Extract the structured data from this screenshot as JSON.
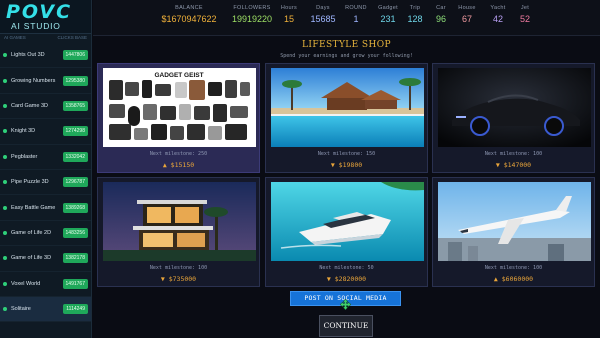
{
  "app": {
    "logo_main": "POVC",
    "logo_sub": "AI STUDIO"
  },
  "sidebar": {
    "header_left": "AI GAMES",
    "header_right": "CLICKS BASE",
    "items": [
      {
        "label": "Lights Out 3D",
        "count": "1447806"
      },
      {
        "label": "Growing Numbers",
        "count": "1295380"
      },
      {
        "label": "Card Game 3D",
        "count": "1358765"
      },
      {
        "label": "Knight 3D",
        "count": "1274298"
      },
      {
        "label": "Pegblaster",
        "count": "1332042"
      },
      {
        "label": "Pipe Puzzle 3D",
        "count": "1296787"
      },
      {
        "label": "Easy Battle Game",
        "count": "1389268"
      },
      {
        "label": "Game of Life 2D",
        "count": "1483256"
      },
      {
        "label": "Game of Life 3D",
        "count": "1382178"
      },
      {
        "label": "Voxel World",
        "count": "1491767"
      },
      {
        "label": "Solitaire",
        "count": "1114249"
      }
    ]
  },
  "stats": [
    {
      "label": "BALANCE",
      "value": "$1670947622",
      "color": "#f0b13a"
    },
    {
      "label": "FOLLOWERS",
      "value": "19919220",
      "color": "#9ee065"
    },
    {
      "label": "Hours",
      "value": "15",
      "color": "#f0b13a"
    },
    {
      "label": "Days",
      "value": "15685",
      "color": "#9fb6ff"
    },
    {
      "label": "ROUND",
      "value": "1",
      "color": "#9fb6ff"
    },
    {
      "label": "Gadget",
      "value": "231",
      "color": "#6fd6e8"
    },
    {
      "label": "Trip",
      "value": "128",
      "color": "#6fd6e8"
    },
    {
      "label": "Car",
      "value": "96",
      "color": "#8fe07a"
    },
    {
      "label": "House",
      "value": "67",
      "color": "#f09aa0"
    },
    {
      "label": "Yacht",
      "value": "42",
      "color": "#b9a0f4"
    },
    {
      "label": "Jet",
      "value": "52",
      "color": "#f07aa0"
    }
  ],
  "shop": {
    "title": "LIFESTYLE SHOP",
    "subtitle": "Spend your earnings and grow your following!",
    "items": [
      {
        "name": "gadget",
        "image_text": "GADGET GEIST",
        "milestone": "Next milestone: 250",
        "price": "▲ $15150",
        "owned": true
      },
      {
        "name": "trip",
        "milestone": "Next milestone: 150",
        "price": "▼ $19800",
        "owned": false
      },
      {
        "name": "car",
        "milestone": "Next milestone: 100",
        "price": "▼ $147000",
        "owned": false
      },
      {
        "name": "house",
        "milestone": "Next milestone: 100",
        "price": "▼ $735000",
        "owned": false
      },
      {
        "name": "yacht",
        "milestone": "Next milestone: 50",
        "price": "▼ $2820000",
        "owned": false
      },
      {
        "name": "jet",
        "milestone": "Next milestone: 100",
        "price": "▲ $6060000",
        "owned": false
      }
    ]
  },
  "buttons": {
    "post": "POST ON SOCIAL MEDIA",
    "continue": "CONTINUE"
  }
}
